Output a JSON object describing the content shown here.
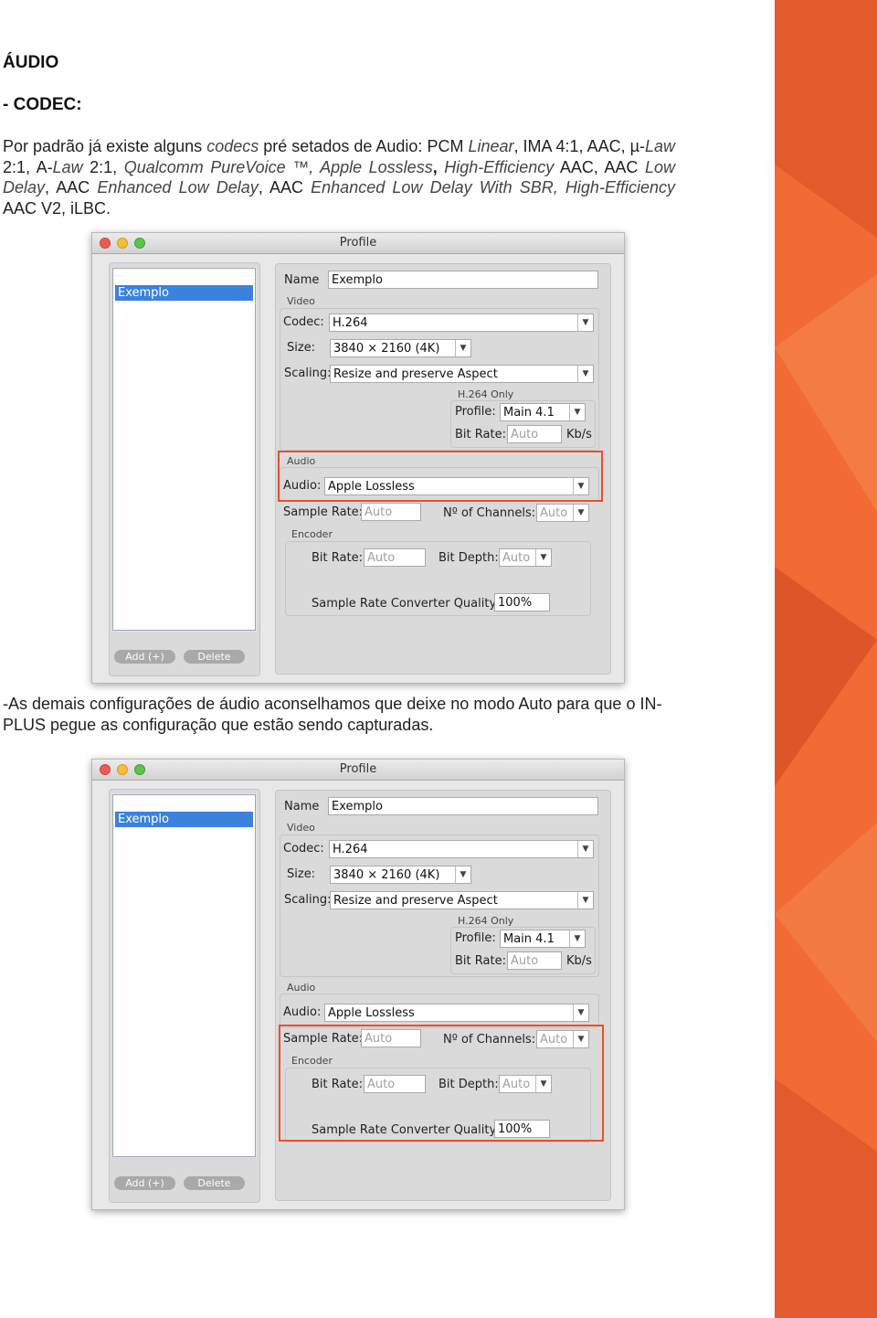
{
  "section_title": "ÁUDIO",
  "subsection_title": "- CODEC:",
  "intro_paragraph": {
    "s1": "Por padrão já existe alguns ",
    "s2": "codecs",
    "s3": " pré setados de Audio: PCM ",
    "s4": "Linear",
    "s5": ", IMA 4:1, AAC, µ-",
    "s6": "Law",
    "s7": " 2:1, A-",
    "s8": "Law",
    "s9": " 2:1, ",
    "s10": "Qualcomm PureVoice ™, Apple Lossless",
    "s11": ", ",
    "s12": "High-Efficiency",
    "s13": " AAC, AAC ",
    "s14": "Low Delay",
    "s15": ", AAC ",
    "s16": "Enhanced Low Delay",
    "s17": ", AAC ",
    "s18": "Enhanced Low Delay With SBR, High-Efficiency",
    "s19": " AAC V2, iLBC."
  },
  "second_paragraph": "-As demais configurações de áudio aconselhamos que deixe no modo Auto para que o IN-PLUS pegue as configuração que estão sendo capturadas.",
  "dialog": {
    "title": "Profile",
    "profile_list_item": "Exemplo",
    "add_button": "Add (+)",
    "delete_button": "Delete",
    "name_label": "Name",
    "name_value": "Exemplo",
    "video_section": "Video",
    "codec_label": "Codec:",
    "codec_value": "H.264",
    "size_label": "Size:",
    "size_value": "3840 × 2160 (4K)",
    "scaling_label": "Scaling:",
    "scaling_value": "Resize and preserve Aspect",
    "h264_section": "H.264 Only",
    "profile_label": "Profile:",
    "profile_value": "Main 4.1",
    "video_bitrate_label": "Bit Rate:",
    "video_bitrate_value": "Auto",
    "video_bitrate_unit": "Kb/s",
    "audio_section": "Audio",
    "audio_label": "Audio:",
    "audio_value": "Apple Lossless",
    "sample_rate_label": "Sample Rate:",
    "sample_rate_value": "Auto",
    "channels_label": "Nº of Channels:",
    "channels_value": "Auto",
    "encoder_section": "Encoder",
    "enc_bitrate_label": "Bit Rate:",
    "enc_bitrate_value": "Auto",
    "bit_depth_label": "Bit Depth:",
    "bit_depth_value": "Auto",
    "src_quality_label": "Sample Rate Converter Quality:",
    "src_quality_value": "100%"
  },
  "colors": {
    "accent_orange": "#f26a34",
    "highlight_red": "#e8502a",
    "selection_blue": "#3a82dc"
  }
}
